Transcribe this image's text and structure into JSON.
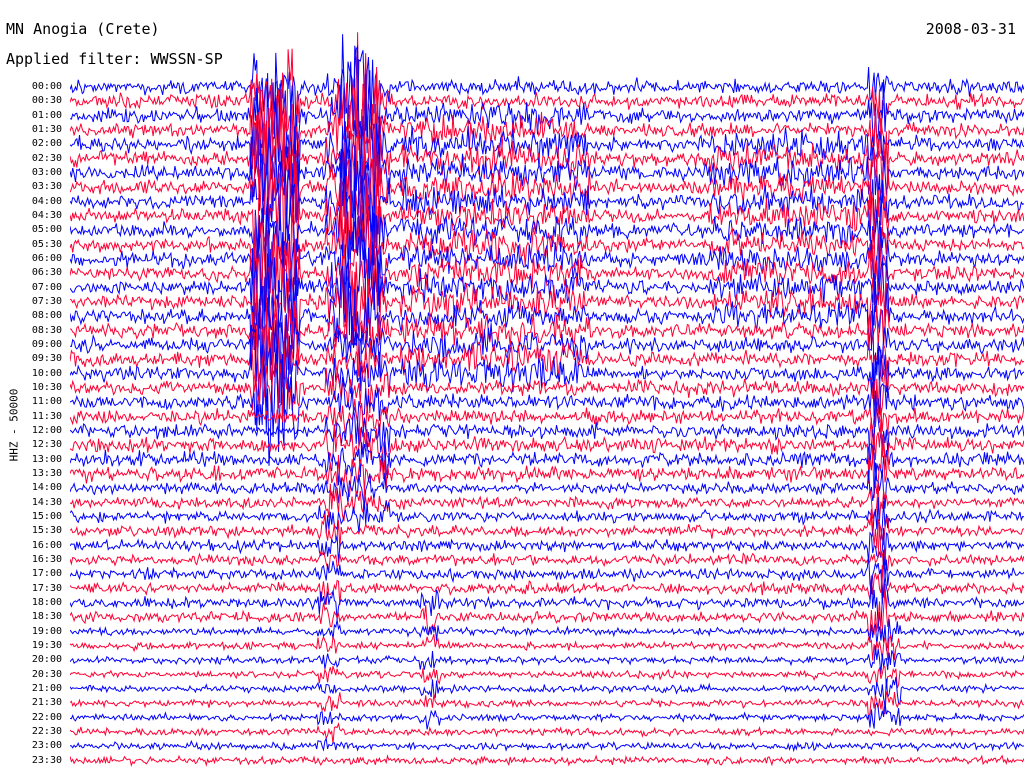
{
  "header": {
    "station": "MN Anogia (Crete)",
    "filter": "Applied filter: WWSSN-SP",
    "date": "2008-03-31",
    "channel_label": "HHZ - 50000"
  },
  "chart_data": {
    "type": "line",
    "title": "MN Anogia (Crete)",
    "date": "2008-03-31",
    "filter": "WWSSN-SP",
    "channel": "HHZ",
    "scale": 50000,
    "row_labels": [
      "00:00",
      "00:30",
      "01:00",
      "01:30",
      "02:00",
      "02:30",
      "03:00",
      "03:30",
      "04:00",
      "04:30",
      "05:00",
      "05:30",
      "06:00",
      "06:30",
      "07:00",
      "07:30",
      "08:00",
      "08:30",
      "09:00",
      "09:30",
      "10:00",
      "10:30",
      "11:00",
      "11:30",
      "12:00",
      "12:30",
      "13:00",
      "13:30",
      "14:00",
      "14:30",
      "15:00",
      "15:30",
      "16:00",
      "16:30",
      "17:00",
      "17:30",
      "18:00",
      "18:30",
      "19:00",
      "19:30",
      "20:00",
      "20:30",
      "21:00",
      "21:30",
      "22:00",
      "22:30",
      "23:00",
      "23:30"
    ],
    "colors": [
      "#0000ff",
      "#ff0033"
    ],
    "grid": false
  }
}
